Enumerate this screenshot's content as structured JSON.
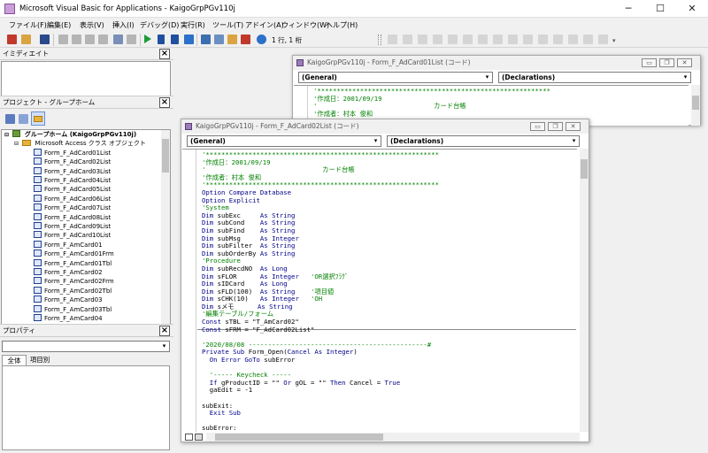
{
  "window": {
    "title": "Microsoft Visual Basic for Applications - KaigoGrpPGv110j",
    "minimize": "─",
    "maximize": "☐",
    "close": "✕"
  },
  "menu": [
    "ファイル(F)",
    "編集(E)",
    "表示(V)",
    "挿入(I)",
    "デバッグ(D)",
    "実行(R)",
    "ツール(T)",
    "アドイン(A)",
    "ウィンドウ(W)",
    "ヘルプ(H)"
  ],
  "toolbar": {
    "position": "1 行, 1 桁"
  },
  "immediate": {
    "title": "イミディエイト"
  },
  "project": {
    "title": "プロジェクト - グループホーム",
    "root": "グループホーム (KaigoGrpPGv110j)",
    "folder": "Microsoft Access クラス オブジェクト",
    "items": [
      "Form_F_AdCard01List",
      "Form_F_AdCard02List",
      "Form_F_AdCard03List",
      "Form_F_AdCard04List",
      "Form_F_AdCard05List",
      "Form_F_AdCard06List",
      "Form_F_AdCard07List",
      "Form_F_AdCard08List",
      "Form_F_AdCard09List",
      "Form_F_AdCard10List",
      "Form_F_AmCard01",
      "Form_F_AmCard01Frm",
      "Form_F_AmCard01Tbl",
      "Form_F_AmCard02",
      "Form_F_AmCard02Frm",
      "Form_F_AmCard02Tbl",
      "Form_F_AmCard03",
      "Form_F_AmCard03Tbl",
      "Form_F_AmCard04"
    ]
  },
  "properties": {
    "title": "プロパティ",
    "tabs": [
      "全体",
      "項目別"
    ]
  },
  "code_window_back": {
    "title": "KaigoGrpPGv110j - Form_F_AdCard01List (コード)",
    "object_combo": "(General)",
    "proc_combo": "(Declarations)",
    "lines": [
      [
        {
          "c": "cm",
          "t": "'************************************************************"
        }
      ],
      [
        {
          "c": "cm",
          "t": "'作成日：2001/09/19"
        }
      ],
      [
        {
          "c": "cm",
          "t": "'                              カード台帳"
        }
      ],
      [
        {
          "c": "cm",
          "t": "'作成者：村本 俊和"
        }
      ]
    ]
  },
  "code_window_front": {
    "title": "KaigoGrpPGv110j - Form_F_AdCard02List (コード)",
    "object_combo": "(General)",
    "proc_combo": "(Declarations)",
    "lines": [
      [
        {
          "c": "cm",
          "t": "'************************************************************"
        }
      ],
      [
        {
          "c": "cm",
          "t": "'作成日：2001/09/19"
        }
      ],
      [
        {
          "c": "cm",
          "t": "'                              カード台帳"
        }
      ],
      [
        {
          "c": "cm",
          "t": "'作成者：村本 俊和"
        }
      ],
      [
        {
          "c": "cm",
          "t": "'************************************************************"
        }
      ],
      [
        {
          "c": "kw",
          "t": "Option Compare Database"
        }
      ],
      [
        {
          "c": "kw",
          "t": "Option Explicit"
        }
      ],
      [
        {
          "c": "cm",
          "t": "'System"
        }
      ],
      [
        {
          "c": "kw",
          "t": "Dim "
        },
        {
          "c": "pl",
          "t": "subExc     "
        },
        {
          "c": "kw",
          "t": "As String"
        }
      ],
      [
        {
          "c": "kw",
          "t": "Dim "
        },
        {
          "c": "pl",
          "t": "subCond    "
        },
        {
          "c": "kw",
          "t": "As String"
        }
      ],
      [
        {
          "c": "kw",
          "t": "Dim "
        },
        {
          "c": "pl",
          "t": "subFind    "
        },
        {
          "c": "kw",
          "t": "As String"
        }
      ],
      [
        {
          "c": "kw",
          "t": "Dim "
        },
        {
          "c": "pl",
          "t": "subMsg     "
        },
        {
          "c": "kw",
          "t": "As Integer"
        }
      ],
      [
        {
          "c": "kw",
          "t": "Dim "
        },
        {
          "c": "pl",
          "t": "subFilter  "
        },
        {
          "c": "kw",
          "t": "As String"
        }
      ],
      [
        {
          "c": "kw",
          "t": "Dim "
        },
        {
          "c": "pl",
          "t": "subOrderBy "
        },
        {
          "c": "kw",
          "t": "As String"
        }
      ],
      [
        {
          "c": "cm",
          "t": "'Procedure"
        }
      ],
      [
        {
          "c": "kw",
          "t": "Dim "
        },
        {
          "c": "pl",
          "t": "subRecdNO  "
        },
        {
          "c": "kw",
          "t": "As Long"
        }
      ],
      [
        {
          "c": "kw",
          "t": "Dim "
        },
        {
          "c": "pl",
          "t": "sFLOR      "
        },
        {
          "c": "kw",
          "t": "As Integer"
        },
        {
          "c": "cm",
          "t": "   'OR選択ﾌﾗｸﾞ"
        }
      ],
      [
        {
          "c": "kw",
          "t": "Dim "
        },
        {
          "c": "pl",
          "t": "sIDCard    "
        },
        {
          "c": "kw",
          "t": "As Long"
        }
      ],
      [
        {
          "c": "kw",
          "t": "Dim "
        },
        {
          "c": "pl",
          "t": "sFLD(100)  "
        },
        {
          "c": "kw",
          "t": "As String"
        },
        {
          "c": "cm",
          "t": "    '項目値"
        }
      ],
      [
        {
          "c": "kw",
          "t": "Dim "
        },
        {
          "c": "pl",
          "t": "sCHK(10)   "
        },
        {
          "c": "kw",
          "t": "As Integer"
        },
        {
          "c": "cm",
          "t": "   'OH"
        }
      ],
      [
        {
          "c": "kw",
          "t": "Dim "
        },
        {
          "c": "pl",
          "t": "sメモ      "
        },
        {
          "c": "kw",
          "t": "As String"
        }
      ],
      [
        {
          "c": "cm",
          "t": "'編集テーブル/フォーム"
        }
      ],
      [
        {
          "c": "kw",
          "t": "Const "
        },
        {
          "c": "pl",
          "t": "sTBL = \"T_AmCard02\""
        }
      ],
      [
        {
          "c": "kw",
          "t": "Const "
        },
        {
          "c": "pl",
          "t": "sFRM = \"F_AdCard02List\""
        }
      ],
      [
        {
          "c": "pl",
          "t": ""
        }
      ],
      [
        {
          "c": "cm",
          "t": "'2020/08/08 ----------------------------------------------#"
        }
      ],
      [
        {
          "c": "kw",
          "t": "Private Sub "
        },
        {
          "c": "pl",
          "t": "Form_Open("
        },
        {
          "c": "kw",
          "t": "Cancel As Integer"
        },
        {
          "c": "pl",
          "t": ")"
        }
      ],
      [
        {
          "c": "kw",
          "t": "  On Error GoTo "
        },
        {
          "c": "pl",
          "t": "subError"
        }
      ],
      [
        {
          "c": "pl",
          "t": ""
        }
      ],
      [
        {
          "c": "cm",
          "t": "  '----- Keycheck -----"
        }
      ],
      [
        {
          "c": "kw",
          "t": "  If "
        },
        {
          "c": "pl",
          "t": "gProductID = \"\" "
        },
        {
          "c": "kw",
          "t": "Or "
        },
        {
          "c": "pl",
          "t": "gOL = \"\" "
        },
        {
          "c": "kw",
          "t": "Then "
        },
        {
          "c": "pl",
          "t": "Cancel = "
        },
        {
          "c": "kw",
          "t": "True"
        }
      ],
      [
        {
          "c": "pl",
          "t": "  gaEdit = -1"
        }
      ],
      [
        {
          "c": "pl",
          "t": ""
        }
      ],
      [
        {
          "c": "pl",
          "t": "subExit:"
        }
      ],
      [
        {
          "c": "kw",
          "t": "  Exit Sub"
        }
      ],
      [
        {
          "c": "pl",
          "t": ""
        }
      ],
      [
        {
          "c": "pl",
          "t": "subError:"
        }
      ]
    ]
  }
}
